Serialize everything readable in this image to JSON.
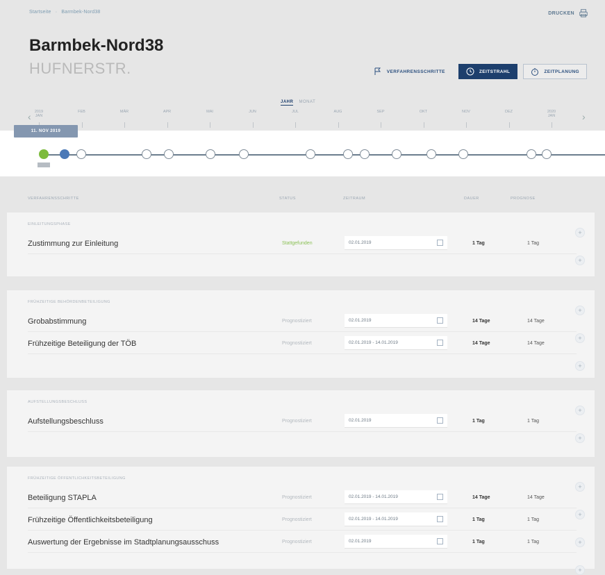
{
  "breadcrumb": [
    "Startseite",
    "Barmbek-Nord38"
  ],
  "header": {
    "print_label": "DRUCKEN",
    "title": "Barmbek-Nord38",
    "subtitle": "HUFNERSTR."
  },
  "view_buttons": {
    "steps": "VERFAHRENSSCHRITTE",
    "timeline": "ZEITSTRAHL",
    "planning": "ZEITPLANUNG"
  },
  "toggle": {
    "year": "JAHR",
    "month": "MONAT"
  },
  "timeline": {
    "ticks": [
      "2019\nJAN",
      "FEB",
      "MÄR",
      "APR",
      "MAI",
      "JUN",
      "JUL",
      "AUG",
      "SEP",
      "OKT",
      "NOV",
      "DEZ",
      "2020\nJAN"
    ],
    "current_date": "11. NOV 2019"
  },
  "columns": {
    "step": "VERFAHRENSSCHRITTE",
    "status": "STATUS",
    "period": "ZEITRAUM",
    "duration": "DAUER",
    "forecast": "PROGNOSE"
  },
  "sections": [
    {
      "label": "EINLEITUNGSPHASE",
      "rows": [
        {
          "name": "Zustimmung zur Einleitung",
          "status": "Stattgefunden",
          "status_color": "#8cc157",
          "period": "02.01.2019",
          "duration": "1 Tag",
          "forecast": "1 Tag"
        }
      ]
    },
    {
      "label": "FRÜHZEITIGE BEHÖRDENBETEILIGUNG",
      "rows": [
        {
          "name": "Grobabstimmung",
          "status": "Prognostiziert",
          "status_color": "#b2b8be",
          "period": "02.01.2019",
          "duration": "14 Tage",
          "forecast": "14 Tage"
        },
        {
          "name": "Frühzeitige Beteiligung der TÖB",
          "status": "Prognostiziert",
          "status_color": "#b2b8be",
          "period": "02.01.2019 - 14.01.2019",
          "duration": "14 Tage",
          "forecast": "14 Tage"
        }
      ]
    },
    {
      "label": "AUFSTELLUNGSBESCHLUSS",
      "rows": [
        {
          "name": "Aufstellungsbeschluss",
          "status": "Prognostiziert",
          "status_color": "#b2b8be",
          "period": "02.01.2019",
          "duration": "1 Tag",
          "forecast": "1 Tag"
        }
      ]
    },
    {
      "label": "FRÜHZEITIGE ÖFFENTLICHKEITSBETEILIGUNG",
      "rows": [
        {
          "name": "Beteiligung STAPLA",
          "status": "Prognostiziert",
          "status_color": "#b2b8be",
          "period": "02.01.2019 - 14.01.2019",
          "duration": "14 Tage",
          "forecast": "14 Tage"
        },
        {
          "name": "Frühzeitige Öffentlichkeitsbeteiligung",
          "status": "Prognostiziert",
          "status_color": "#b2b8be",
          "period": "02.01.2019 - 14.01.2019",
          "duration": "1 Tag",
          "forecast": "1 Tag"
        },
        {
          "name": "Auswertung der Ergebnisse im Stadtplanungsausschuss",
          "status": "Prognostiziert",
          "status_color": "#b2b8be",
          "period": "02.01.2019",
          "duration": "1 Tag",
          "forecast": "1 Tag"
        }
      ]
    }
  ]
}
